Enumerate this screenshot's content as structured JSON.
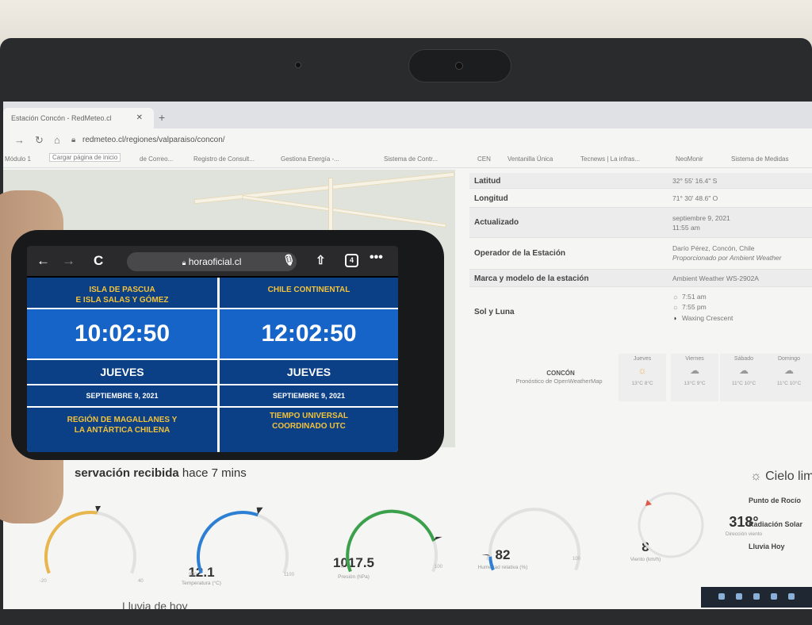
{
  "browser": {
    "tab_title": "Estación Concón - RedMeteo.cl",
    "url": "redmeteo.cl/regiones/valparaiso/concon/",
    "bookmarks": [
      "Módulo 1",
      "Cargar página de inicio",
      "de Correo...",
      "Registro de Consult...",
      "Gestiona Energía -...",
      "Sistema de Contr...",
      "CEN",
      "Ventanilla Única",
      "Tecnews | La infras...",
      "NeoMonir",
      "Sistema de Medidas"
    ]
  },
  "station_info": {
    "rows": [
      {
        "label": "Latitud",
        "value": "32° 55' 16.4\" S"
      },
      {
        "label": "Longitud",
        "value": "71° 30' 48.6\" O"
      },
      {
        "label": "Actualizado",
        "value": "septiembre 9, 2021",
        "value2": "11:55 am"
      },
      {
        "label": "Operador de la Estación",
        "value": "Darío Pérez, Concón, Chile",
        "value2": "Proporcionado por Ambient Weather"
      },
      {
        "label": "Marca y modelo de la estación",
        "value": "Ambient Weather WS-2902A"
      },
      {
        "label": "Sol y Luna",
        "value": "7:51 am",
        "value2": "7:55 pm",
        "value3": "Waxing Crescent"
      }
    ]
  },
  "forecast": {
    "city": "CONCÓN",
    "subtitle": "Pronóstico de OpenWeatherMap",
    "days": [
      {
        "name": "Jueves",
        "temps": "13°C  8°C",
        "icon": "sun-icon"
      },
      {
        "name": "Viernes",
        "temps": "13°C  9°C",
        "icon": "cloud-icon"
      },
      {
        "name": "Sábado",
        "temps": "11°C  10°C",
        "icon": "cloud-icon"
      },
      {
        "name": "Domingo",
        "temps": "11°C  10°C",
        "icon": "cloud-icon"
      }
    ]
  },
  "observation": {
    "title_bold": "servación recibida",
    "title_rest": " hace 7 mins"
  },
  "gauges": [
    {
      "value": "12.1",
      "label": "Temperatura (°C)",
      "min": "-20",
      "max": "40",
      "level": 0.54,
      "color": "#e8b64c"
    },
    {
      "value": "1017.5",
      "label": "Presión (hPa)",
      "min": "900",
      "max": "1100",
      "level": 0.59,
      "color": "#2d7fd3"
    },
    {
      "value": "82",
      "label": "Humedad relativa (%)",
      "min": "0",
      "max": "100",
      "level": 0.82,
      "color": "#3aa04a"
    },
    {
      "value": "8",
      "label": "Viento (km/h)",
      "min": "0",
      "max": "100",
      "level": 0.08,
      "color": "#2d7fd3"
    }
  ],
  "wind_direction": {
    "value": "318°",
    "label": "Dirección viento"
  },
  "sky": {
    "title": "Cielo lim",
    "rows": [
      "Punto de Rocío",
      "Radiación Solar",
      "Lluvia Hoy"
    ]
  },
  "footer_partial": "Lluvia de hoy",
  "phone": {
    "url": "horaoficial.cl",
    "tabs_count": "4",
    "cells": {
      "region_left": [
        "ISLA DE PASCUA",
        "E ISLA SALAS Y GÓMEZ"
      ],
      "region_right": [
        "CHILE CONTINENTAL"
      ],
      "time_left": "10:02:50",
      "time_right": "12:02:50",
      "day_left": "JUEVES",
      "day_right": "JUEVES",
      "date_left": "SEPTIEMBRE 9, 2021",
      "date_right": "SEPTIEMBRE 9, 2021",
      "bottom_left": [
        "REGIÓN DE MAGALLANES Y",
        "LA ANTÁRTICA CHILENA"
      ],
      "bottom_right": [
        "TIEMPO UNIVERSAL",
        "COORDINADO UTC"
      ]
    }
  },
  "colors": {
    "phone_cell_dark": "#0b3f86",
    "phone_cell_time": "#1664c8",
    "phone_region_text": "#f2c23a"
  }
}
